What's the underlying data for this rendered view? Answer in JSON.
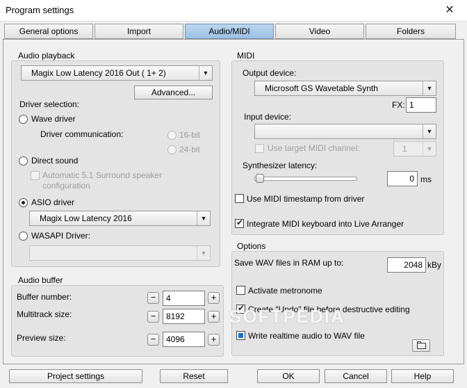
{
  "window": {
    "title": "Program settings",
    "close_glyph": "✕"
  },
  "tabs": [
    {
      "label": "General options"
    },
    {
      "label": "Import"
    },
    {
      "label": "Audio/MIDI",
      "active": true
    },
    {
      "label": "Video"
    },
    {
      "label": "Folders"
    }
  ],
  "audio_playback": {
    "label": "Audio playback",
    "device": "Magix Low Latency 2016 Out ( 1+ 2)",
    "advanced_button": "Advanced...",
    "driver_selection_label": "Driver selection:",
    "wave_driver": {
      "label": "Wave driver",
      "selected": false
    },
    "driver_communication_label": "Driver communication:",
    "bit16": {
      "label": "16-bit",
      "enabled": false
    },
    "bit24": {
      "label": "24-bit",
      "enabled": false
    },
    "direct_sound": {
      "label": "Direct sound",
      "selected": false
    },
    "surround": {
      "label_line1": "Automatic 5.1 Surround speaker",
      "label_line2": "configuration",
      "enabled": false
    },
    "asio_driver": {
      "label": "ASIO driver",
      "selected": true
    },
    "asio_device": "Magix Low Latency 2016",
    "wasapi": {
      "label": "WASAPI Driver:",
      "selected": false
    },
    "wasapi_device": ""
  },
  "audio_buffer": {
    "label": "Audio buffer",
    "buffer_number_label": "Buffer number:",
    "buffer_number": "4",
    "multitrack_label": "Multitrack size:",
    "multitrack_size": "8192",
    "preview_label": "Preview size:",
    "preview_size": "4096",
    "minus": "−",
    "plus": "+"
  },
  "midi": {
    "label": "MIDI",
    "output_label": "Output device:",
    "output_device": "Microsoft GS Wavetable Synth",
    "fx_label": "FX:",
    "fx_value": "1",
    "input_label": "Input device:",
    "input_device": "",
    "use_target_channel": {
      "label": "Use target MIDI channel:",
      "enabled": false,
      "checked": false
    },
    "target_channel": "1",
    "synth_latency_label": "Synthesizer latency:",
    "synth_latency_value": "0",
    "synth_latency_unit": "ms",
    "synth_latency_level": 0,
    "use_timestamp": {
      "label": "Use MIDI timestamp from driver",
      "checked": false
    },
    "integrate_keyboard": {
      "label": "Integrate MIDI keyboard into Live Arranger",
      "checked": true
    }
  },
  "options": {
    "label": "Options",
    "save_wav_label": "Save WAV files in RAM up to:",
    "save_wav_value": "2048",
    "save_wav_unit": "kBy",
    "metronome": {
      "label": "Activate metronome",
      "checked": false
    },
    "undo_file": {
      "label": "Create \"Undo\" file before destructive editing",
      "checked": true
    },
    "realtime_wav": {
      "label": "Write realtime audio to WAV file",
      "checked": true
    }
  },
  "watermark": "SOFTPEDIA",
  "bottom_buttons": {
    "project_settings": "Project settings",
    "reset": "Reset",
    "ok": "OK",
    "cancel": "Cancel",
    "help": "Help"
  }
}
